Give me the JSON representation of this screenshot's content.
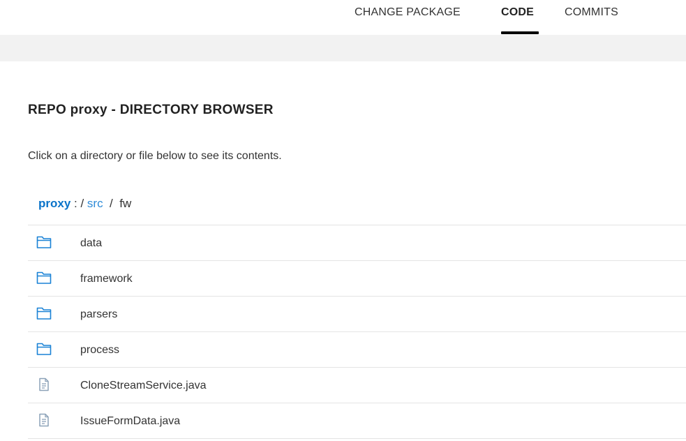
{
  "tabs": [
    {
      "label": "CHANGE PACKAGE",
      "active": false
    },
    {
      "label": "CODE",
      "active": true
    },
    {
      "label": "COMMITS",
      "active": false
    }
  ],
  "heading": {
    "prefix": "REPO",
    "repo_name": "proxy",
    "suffix": "- DIRECTORY BROWSER"
  },
  "instruction": "Click on a directory or file below to see its contents.",
  "breadcrumb": {
    "root": "proxy",
    "root_separator": " : / ",
    "segments": [
      "src"
    ],
    "separator": "  /  ",
    "current": "fw"
  },
  "entries": [
    {
      "name": "data",
      "type": "folder",
      "icon": "folder-icon"
    },
    {
      "name": "framework",
      "type": "folder",
      "icon": "folder-icon"
    },
    {
      "name": "parsers",
      "type": "folder",
      "icon": "folder-icon"
    },
    {
      "name": "process",
      "type": "folder",
      "icon": "folder-icon"
    },
    {
      "name": "CloneStreamService.java",
      "type": "file",
      "icon": "file-icon"
    },
    {
      "name": "IssueFormData.java",
      "type": "file",
      "icon": "file-icon"
    }
  ],
  "colors": {
    "accent": "#0a73c9",
    "link": "#2e8bd8",
    "folder_icon": "#1a82d6",
    "file_icon": "#8ca2b8",
    "band": "#f2f2f2",
    "divider": "#e4e4e4"
  }
}
